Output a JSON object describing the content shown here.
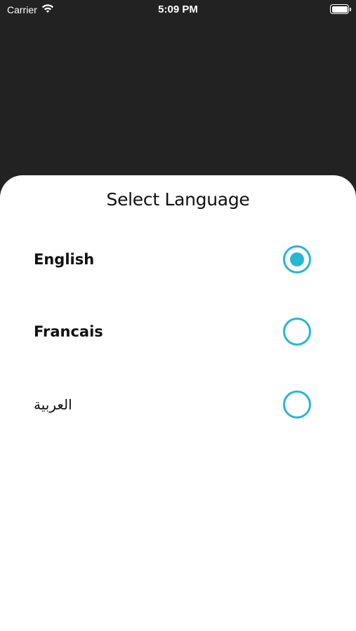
{
  "status_bar": {
    "carrier": "Carrier",
    "time": "5:09 PM",
    "wifi_icon": "wifi-icon",
    "battery_icon": "battery-icon",
    "battery_level": 1.0
  },
  "sheet": {
    "title": "Select Language",
    "accent_color": "#27b6d4",
    "options": [
      {
        "label": "English",
        "selected": true
      },
      {
        "label": "Francais",
        "selected": false
      },
      {
        "label": "العربية",
        "selected": false
      }
    ]
  }
}
